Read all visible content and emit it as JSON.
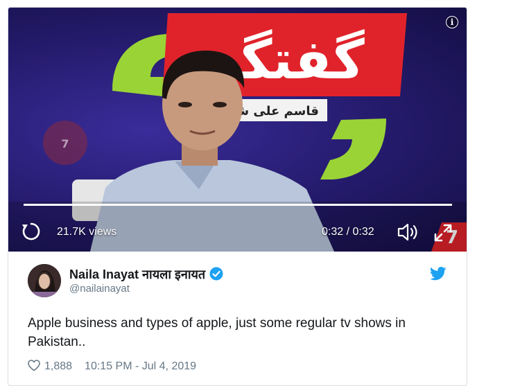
{
  "video": {
    "views": "21.7K views",
    "time": "0:32 / 0:32",
    "progress": 1.0,
    "overlay_title_urdu": "گفتگو",
    "overlay_subtitle_urdu": "قاسم علی شاہ",
    "channel_logo_text": "7",
    "icons": [
      "info-icon",
      "replay-icon",
      "volume-icon",
      "expand-icon"
    ]
  },
  "tweet": {
    "display_name": "Naila Inayat नायला इनायत",
    "handle": "@nailainayat",
    "text": "Apple business and types of apple, just some regular tv shows in Pakistan..",
    "likes": "1,888",
    "timestamp": "10:15 PM - Jul 4, 2019",
    "icons": [
      "verified-icon",
      "twitter-bird-icon",
      "heart-icon"
    ]
  },
  "colors": {
    "twitter_blue": "#1da1f2",
    "text_primary": "#14171a",
    "text_secondary": "#657786",
    "overlay_red": "#e0232b",
    "overlay_green": "#9ad336"
  }
}
